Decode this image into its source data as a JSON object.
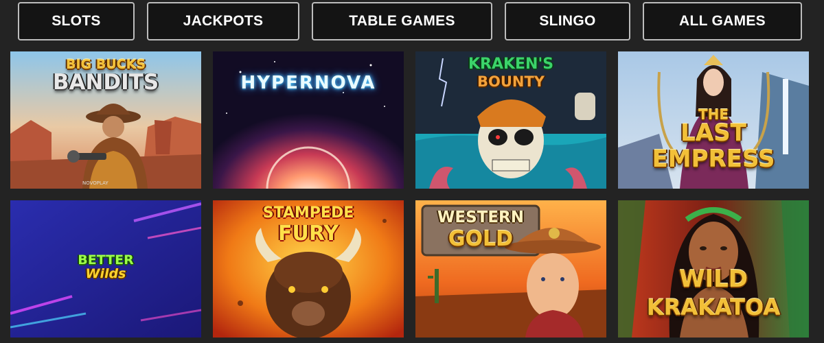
{
  "nav": {
    "tabs": [
      {
        "label": "SLOTS"
      },
      {
        "label": "JACKPOTS"
      },
      {
        "label": "TABLE GAMES"
      },
      {
        "label": "SLINGO"
      },
      {
        "label": "ALL GAMES"
      }
    ]
  },
  "games": [
    {
      "title_line1": "BIG BUCKS",
      "title_line2": "BANDITS",
      "provider_mark": "NOVOPLAY",
      "icon": "cowboy-bandit-art"
    },
    {
      "title_line1": "HYPERNOVA",
      "icon": "exploding-star-art"
    },
    {
      "title_line1": "KRAKEN'S",
      "title_line2": "BOUNTY",
      "icon": "pirate-skull-art"
    },
    {
      "title_line1": "THE",
      "title_line2": "LAST",
      "title_line3": "EMPRESS",
      "icon": "empress-art"
    },
    {
      "title_line1": "BETTER",
      "title_line2": "Wilds",
      "icon": "neon-lines-art"
    },
    {
      "title_line1": "STAMPEDE",
      "title_line2": "FURY",
      "icon": "buffalo-art"
    },
    {
      "title_line1": "WESTERN",
      "title_line2": "GOLD",
      "icon": "sheriff-cowboy-art"
    },
    {
      "title_line1": "WILD",
      "title_line2": "KRAKATOA",
      "icon": "island-woman-art"
    }
  ]
}
